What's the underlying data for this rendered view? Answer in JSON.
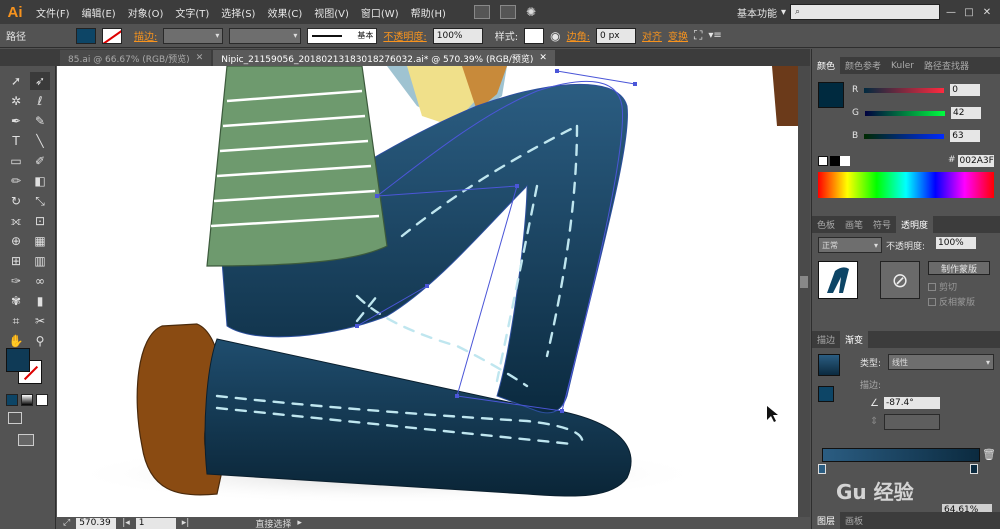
{
  "app": {
    "logo": "Ai"
  },
  "menu": [
    "文件(F)",
    "编辑(E)",
    "对象(O)",
    "文字(T)",
    "选择(S)",
    "效果(C)",
    "视图(V)",
    "窗口(W)",
    "帮助(H)"
  ],
  "workspace": {
    "label": "基本功能",
    "arrow": "▾",
    "search_icon": "search-icon"
  },
  "window_controls": [
    "—",
    "□",
    "✕"
  ],
  "control_bar": {
    "object_type": "路径",
    "stroke_label": "描边:",
    "stroke_profile": "基本",
    "opacity_label": "不透明度:",
    "opacity_value": "100%",
    "style_label": "样式:",
    "corner_label": "边角:",
    "corner_value": "0 px",
    "align_label": "对齐",
    "transform_label": "变换",
    "fill_color": "#0d4566"
  },
  "tabs": [
    {
      "label": "85.ai @ 66.67% (RGB/预览)",
      "close": "✕"
    },
    {
      "label": "Nipic_21159056_20180213183018276032.ai* @ 570.39% (RGB/预览)",
      "close": "✕"
    }
  ],
  "status": {
    "zoom": "570.39",
    "page": "1",
    "tool_name": "直接选择"
  },
  "color_panel": {
    "tabs": [
      "颜色",
      "颜色参考",
      "Kuler",
      "路径查找器"
    ],
    "r_label": "R",
    "r_value": "0",
    "g_label": "G",
    "g_value": "42",
    "b_label": "B",
    "b_value": "63",
    "hex_label": "#",
    "hex_value": "002A3F",
    "color": "#002a3f"
  },
  "transparency_panel": {
    "tabs": [
      "色板",
      "画笔",
      "符号",
      "透明度"
    ],
    "blend_mode": "正常",
    "opacity_label": "不透明度:",
    "opacity_value": "100%",
    "make_mask": "制作蒙版",
    "clip": "剪切",
    "invert_mask": "反相蒙版"
  },
  "gradient_panel": {
    "tabs": [
      "描边",
      "渐变"
    ],
    "type_label": "类型:",
    "type_value": "线性",
    "stroke_label": "描边:",
    "angle_value": "-87.4°",
    "location_value": "64.61%",
    "start_color": "#2b5d82",
    "end_color": "#0b2a3f"
  },
  "layers_panel": {
    "tabs": [
      "图层",
      "画板"
    ]
  },
  "watermark": {
    "text": "Gu 经验"
  }
}
